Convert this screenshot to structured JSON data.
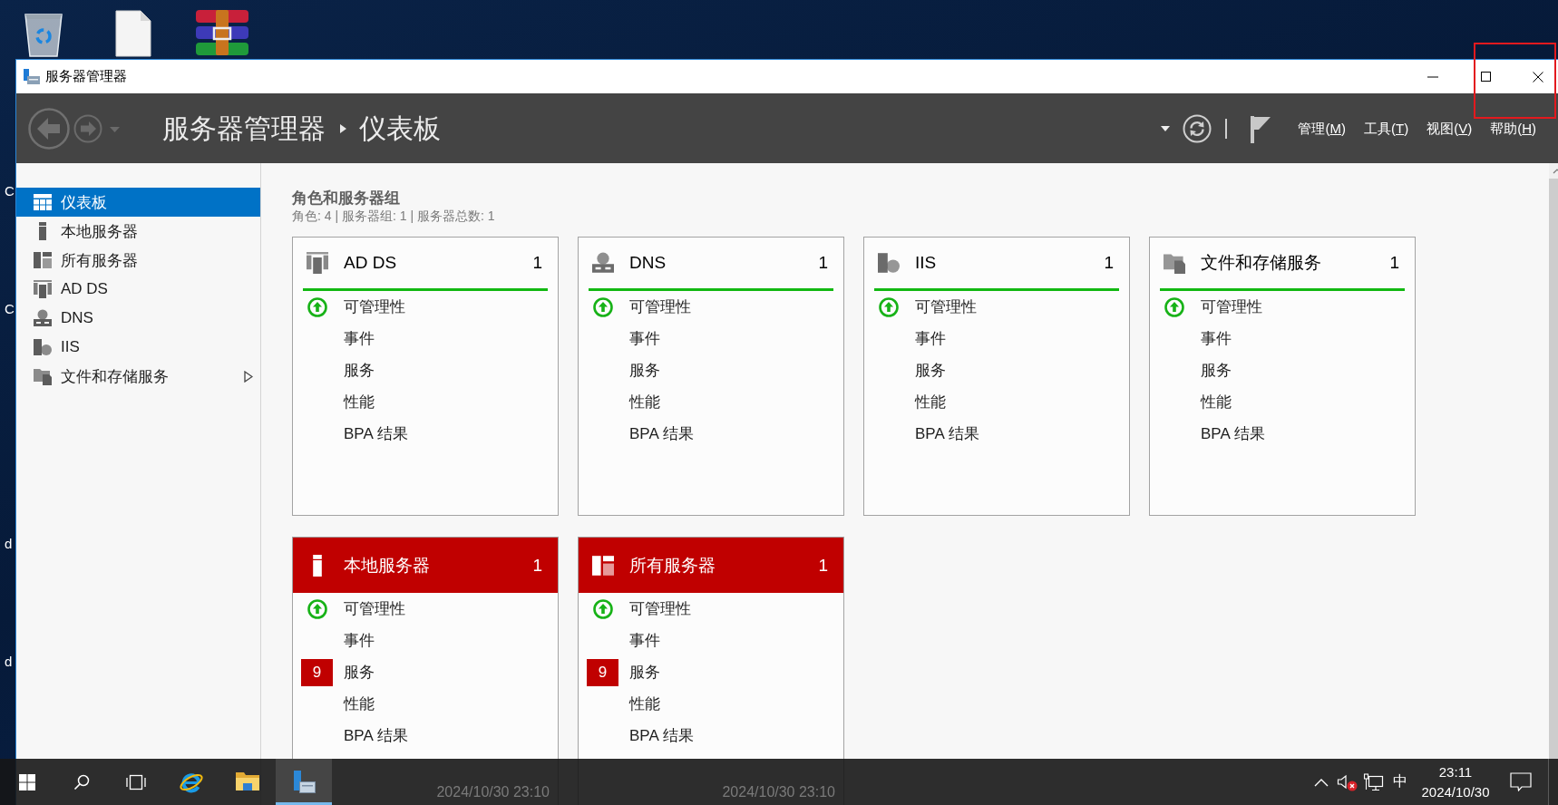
{
  "desktop": {
    "edge_labels": [
      "C",
      "C",
      "d",
      "d"
    ]
  },
  "window": {
    "title": "服务器管理器"
  },
  "header": {
    "breadcrumb": [
      "服务器管理器",
      "仪表板"
    ],
    "menus": [
      {
        "before": "管理(",
        "key": "M",
        "after": ")"
      },
      {
        "before": "工具(",
        "key": "T",
        "after": ")"
      },
      {
        "before": "视图(",
        "key": "V",
        "after": ")"
      },
      {
        "before": "帮助(",
        "key": "H",
        "after": ")"
      }
    ]
  },
  "sidebar": {
    "items": [
      {
        "kind": "dashboard",
        "label": "仪表板",
        "selected": true,
        "submenu": false
      },
      {
        "kind": "local-server",
        "label": "本地服务器",
        "selected": false,
        "submenu": false
      },
      {
        "kind": "all-servers",
        "label": "所有服务器",
        "selected": false,
        "submenu": false
      },
      {
        "kind": "ad-ds",
        "label": "AD DS",
        "selected": false,
        "submenu": false
      },
      {
        "kind": "dns",
        "label": "DNS",
        "selected": false,
        "submenu": false
      },
      {
        "kind": "iis",
        "label": "IIS",
        "selected": false,
        "submenu": false
      },
      {
        "kind": "file-storage",
        "label": "文件和存储服务",
        "selected": false,
        "submenu": true
      }
    ]
  },
  "main": {
    "title": "角色和服务器组",
    "summary": "角色: 4 | 服务器组: 1 | 服务器总数: 1",
    "tiles": [
      {
        "kind": "ad-ds",
        "title": "AD DS",
        "count": "1",
        "alert": false,
        "rows": [
          {
            "kind": "status",
            "label": "可管理性"
          },
          {
            "kind": "plain",
            "label": "事件"
          },
          {
            "kind": "plain",
            "label": "服务"
          },
          {
            "kind": "plain",
            "label": "性能"
          },
          {
            "kind": "plain",
            "label": "BPA 结果"
          }
        ]
      },
      {
        "kind": "dns",
        "title": "DNS",
        "count": "1",
        "alert": false,
        "rows": [
          {
            "kind": "status",
            "label": "可管理性"
          },
          {
            "kind": "plain",
            "label": "事件"
          },
          {
            "kind": "plain",
            "label": "服务"
          },
          {
            "kind": "plain",
            "label": "性能"
          },
          {
            "kind": "plain",
            "label": "BPA 结果"
          }
        ]
      },
      {
        "kind": "iis",
        "title": "IIS",
        "count": "1",
        "alert": false,
        "rows": [
          {
            "kind": "status",
            "label": "可管理性"
          },
          {
            "kind": "plain",
            "label": "事件"
          },
          {
            "kind": "plain",
            "label": "服务"
          },
          {
            "kind": "plain",
            "label": "性能"
          },
          {
            "kind": "plain",
            "label": "BPA 结果"
          }
        ]
      },
      {
        "kind": "file-storage",
        "title": "文件和存储服务",
        "count": "1",
        "alert": false,
        "rows": [
          {
            "kind": "status",
            "label": "可管理性"
          },
          {
            "kind": "plain",
            "label": "事件"
          },
          {
            "kind": "plain",
            "label": "服务"
          },
          {
            "kind": "plain",
            "label": "性能"
          },
          {
            "kind": "plain",
            "label": "BPA 结果"
          }
        ]
      },
      {
        "kind": "local-server",
        "title": "本地服务器",
        "count": "1",
        "alert": true,
        "rows": [
          {
            "kind": "status",
            "label": "可管理性"
          },
          {
            "kind": "plain",
            "label": "事件"
          },
          {
            "kind": "alert",
            "label": "服务",
            "badge": "9"
          },
          {
            "kind": "plain",
            "label": "性能"
          },
          {
            "kind": "plain",
            "label": "BPA 结果"
          }
        ],
        "timestamp": "2024/10/30 23:10"
      },
      {
        "kind": "all-servers",
        "title": "所有服务器",
        "count": "1",
        "alert": true,
        "rows": [
          {
            "kind": "status",
            "label": "可管理性"
          },
          {
            "kind": "plain",
            "label": "事件"
          },
          {
            "kind": "alert",
            "label": "服务",
            "badge": "9"
          },
          {
            "kind": "plain",
            "label": "性能"
          },
          {
            "kind": "plain",
            "label": "BPA 结果"
          }
        ],
        "timestamp": "2024/10/30 23:10"
      }
    ]
  },
  "taskbar": {
    "apps": [
      {
        "kind": "browser",
        "selected": false
      },
      {
        "kind": "folder",
        "selected": false
      },
      {
        "kind": "server-manager",
        "selected": true
      }
    ],
    "tray": {
      "ime": "中",
      "time": "23:11",
      "date": "2024/10/30"
    }
  }
}
